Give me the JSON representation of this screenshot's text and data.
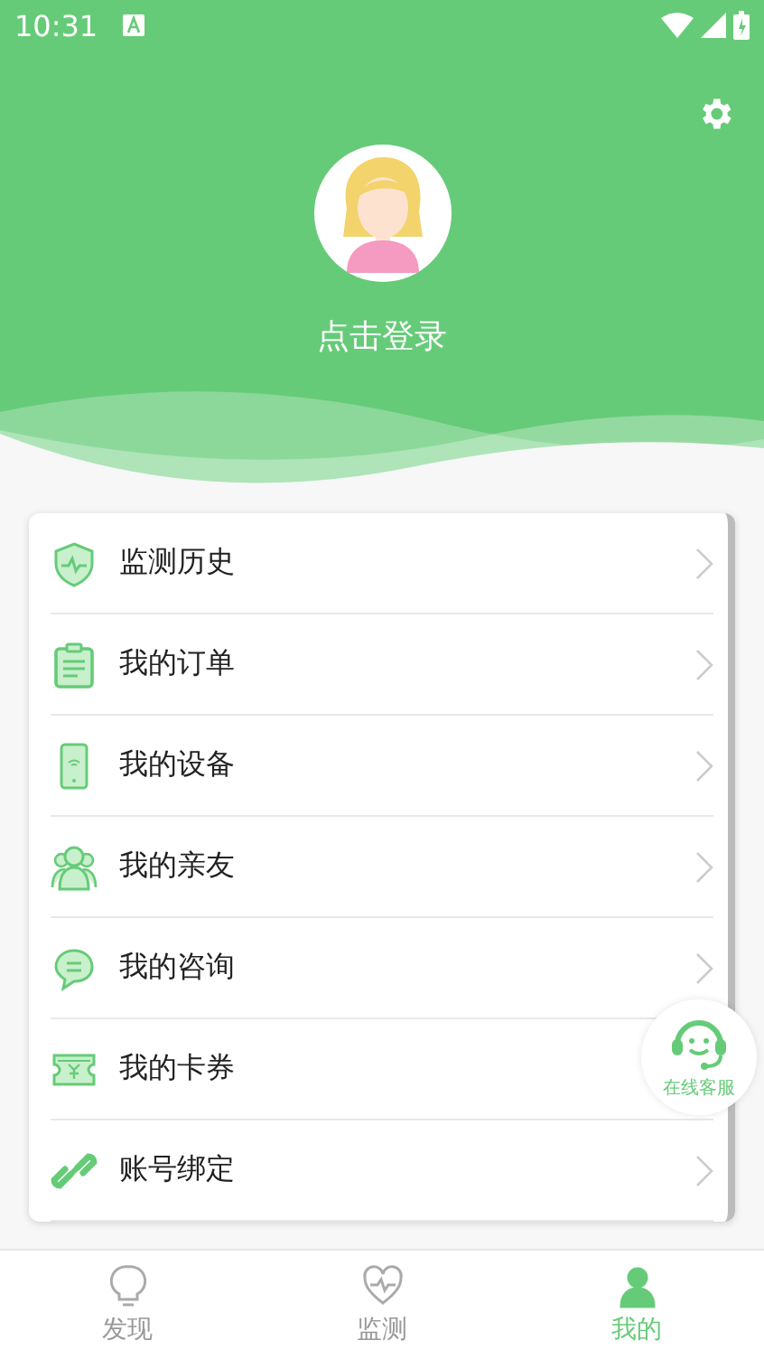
{
  "status_bar": {
    "time": "10:31"
  },
  "profile": {
    "login_text": "点击登录"
  },
  "menu": [
    {
      "kind": "history",
      "label": "监测历史"
    },
    {
      "kind": "orders",
      "label": "我的订单"
    },
    {
      "kind": "device",
      "label": "我的设备"
    },
    {
      "kind": "friends",
      "label": "我的亲友"
    },
    {
      "kind": "consult",
      "label": "我的咨询"
    },
    {
      "kind": "coupon",
      "label": "我的卡券"
    },
    {
      "kind": "binding",
      "label": "账号绑定"
    }
  ],
  "support_button": {
    "label": "在线客服"
  },
  "tab_bar": [
    {
      "kind": "discover",
      "label": "发现",
      "selected": false
    },
    {
      "kind": "monitor",
      "label": "监测",
      "selected": false
    },
    {
      "kind": "me",
      "label": "我的",
      "selected": true
    }
  ]
}
